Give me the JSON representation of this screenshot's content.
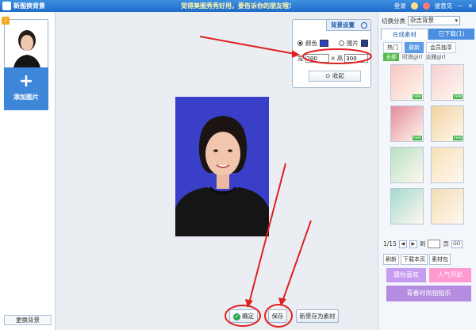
{
  "titlebar": {
    "app_title": "新图换背景",
    "slogan": "觉得美图秀秀好用，要告诉你的朋友哦！",
    "login": "登录",
    "feedback": "提意见"
  },
  "left": {
    "add_photo": "添加图片",
    "change_bg": "更换背景"
  },
  "bg_settings": {
    "title": "背景设置",
    "color_label": "颜色",
    "image_label": "图片",
    "width_label": "宽",
    "width_value": "200",
    "times": "×",
    "height_label": "高",
    "height_value": "300",
    "collapse": "收起",
    "swatch_color": "#2940c8"
  },
  "bottom": {
    "confirm": "确定",
    "save": "保存",
    "save_as_material": "新景存为素材"
  },
  "right": {
    "category_label": "切换分类",
    "category_value": "杂志背景",
    "tab_online": "在线素材",
    "tab_downloaded": "已下载(1)",
    "sub_hot": "热门",
    "sub_new": "最新",
    "sub_member": "会员独享",
    "filter_all": "全部",
    "filter_1": "时尚girl",
    "filter_2": "淡雅girl",
    "page": "1/15",
    "goto": "到",
    "page_unit": "页",
    "go": "GO",
    "refresh": "刷新",
    "download_page": "下载本页",
    "material_pack": "素材包",
    "promo1": "猜你喜欢",
    "promo2": "人气开趴",
    "promo3": "青春时尚拍拍乐",
    "tiles": [
      "#f7c5c0",
      "#f5d0d2",
      "#e38a9b",
      "#f2d3a0",
      "#b6e0c5",
      "#f7e0b8",
      "#a4d8d0",
      "#f3ddb5"
    ]
  }
}
